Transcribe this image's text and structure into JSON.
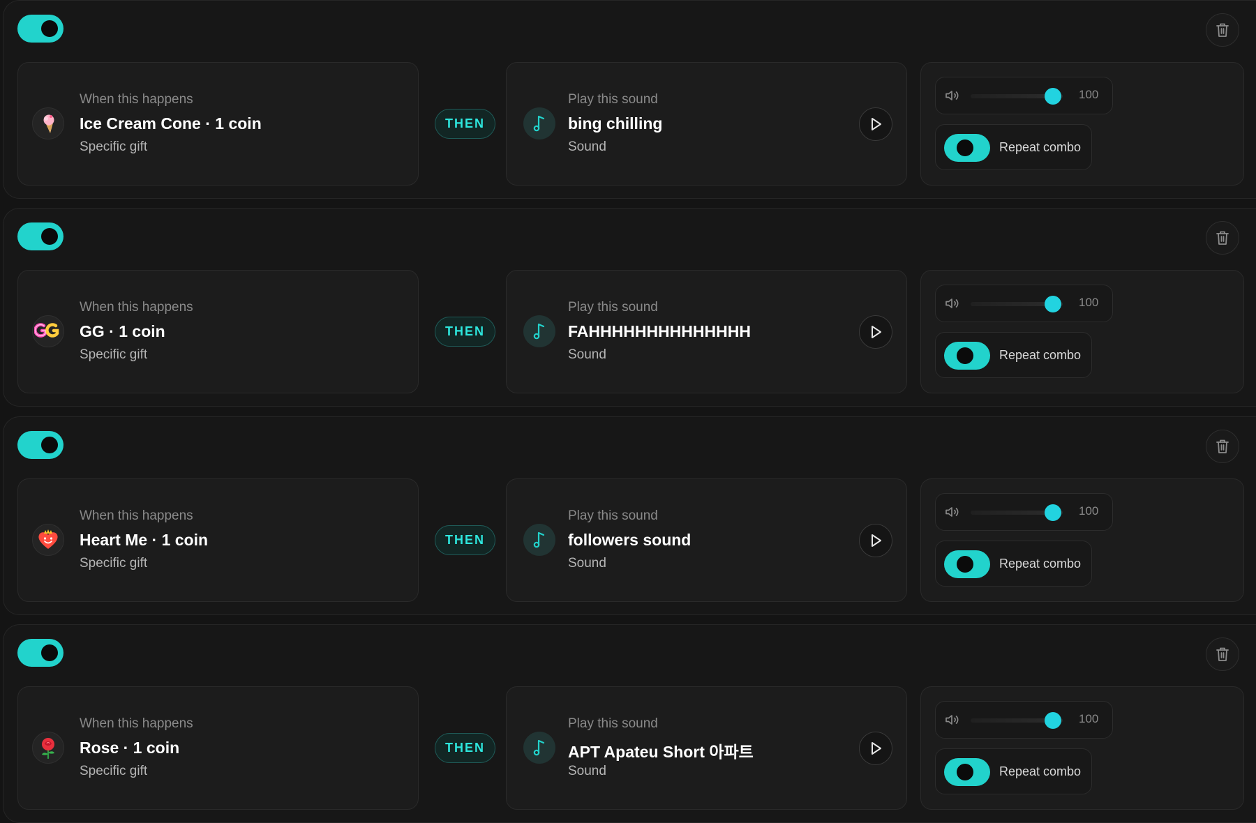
{
  "rules": [
    {
      "enabled": true,
      "trigger": {
        "heading": "When this happens",
        "name": "Ice Cream Cone · 1 coin",
        "type": "Specific gift",
        "icon": "ice-cream-icon"
      },
      "connector": "THEN",
      "action": {
        "heading": "Play this sound",
        "name": "bing chilling",
        "type": "Sound"
      },
      "volume": 100,
      "volume_label": "100",
      "repeat_combo": {
        "enabled": true,
        "label": "Repeat combo"
      }
    },
    {
      "enabled": true,
      "trigger": {
        "heading": "When this happens",
        "name": "GG · 1 coin",
        "type": "Specific gift",
        "icon": "gg-icon"
      },
      "connector": "THEN",
      "action": {
        "heading": "Play this sound",
        "name": "FAHHHHHHHHHHHHHH",
        "type": "Sound"
      },
      "volume": 100,
      "volume_label": "100",
      "repeat_combo": {
        "enabled": true,
        "label": "Repeat combo"
      }
    },
    {
      "enabled": true,
      "trigger": {
        "heading": "When this happens",
        "name": "Heart Me · 1 coin",
        "type": "Specific gift",
        "icon": "heart-me-icon"
      },
      "connector": "THEN",
      "action": {
        "heading": "Play this sound",
        "name": "followers sound",
        "type": "Sound"
      },
      "volume": 100,
      "volume_label": "100",
      "repeat_combo": {
        "enabled": true,
        "label": "Repeat combo"
      }
    },
    {
      "enabled": true,
      "trigger": {
        "heading": "When this happens",
        "name": "Rose · 1 coin",
        "type": "Specific gift",
        "icon": "rose-icon"
      },
      "connector": "THEN",
      "action": {
        "heading": "Play this sound",
        "name": "APT Apateu Short 아파트",
        "type": "Sound"
      },
      "volume": 100,
      "volume_label": "100",
      "repeat_combo": {
        "enabled": true,
        "label": "Repeat combo"
      }
    }
  ],
  "colors": {
    "accent": "#22d3cc",
    "slider_thumb": "#22d3e0",
    "background": "#141414",
    "card": "#1c1c1c",
    "muted_text": "#8a8a8a"
  }
}
